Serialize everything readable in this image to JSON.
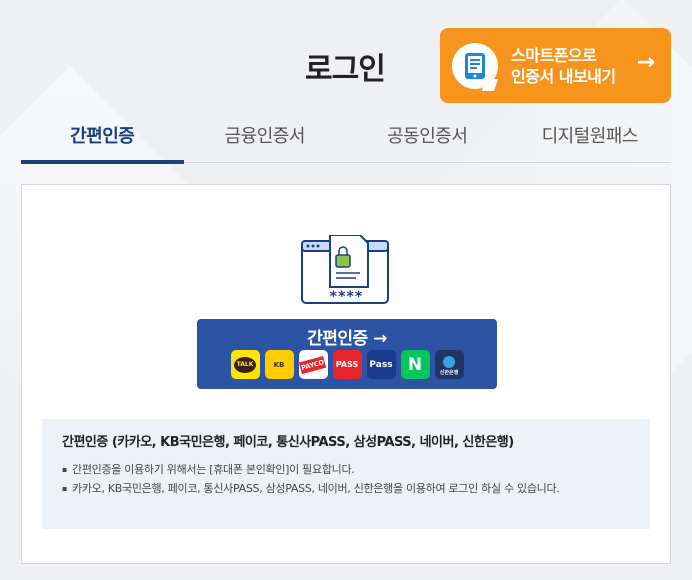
{
  "header": {
    "title": "로그인",
    "export_button": {
      "line1": "스마트폰으로",
      "line2": "인증서 내보내기",
      "arrow": "→"
    }
  },
  "tabs": [
    {
      "label": "간편인증",
      "active": true
    },
    {
      "label": "금융인증서",
      "active": false
    },
    {
      "label": "공동인증서",
      "active": false
    },
    {
      "label": "디지털원패스",
      "active": false
    }
  ],
  "illustration": {
    "password_mask": "****"
  },
  "simple_auth_button": {
    "label": "간편인증 →",
    "providers": [
      {
        "name": "kakao",
        "text": "TALK"
      },
      {
        "name": "kb",
        "text": "KB"
      },
      {
        "name": "payco",
        "text": "PAYCO"
      },
      {
        "name": "pass",
        "text": "PASS"
      },
      {
        "name": "samsung-pass",
        "text": "Pass"
      },
      {
        "name": "naver",
        "text": "N"
      },
      {
        "name": "shinhan",
        "text": "신한은행"
      }
    ]
  },
  "info": {
    "title": "간편인증 (카카오, KB국민은행, 페이코, 통신사PASS, 삼성PASS, 네이버, 신한은행)",
    "items": [
      "간편인증을 이용하기 위해서는 [휴대폰 본인확인]이 필요합니다.",
      "카카오, KB국민은행, 페이코, 통신사PASS, 삼성PASS, 네이버, 신한은행을 이용하여 로그인 하실 수 있습니다."
    ]
  },
  "colors": {
    "accent": "#1d3e7f",
    "button_blue": "#2d53a4",
    "orange": "#f7941d"
  }
}
